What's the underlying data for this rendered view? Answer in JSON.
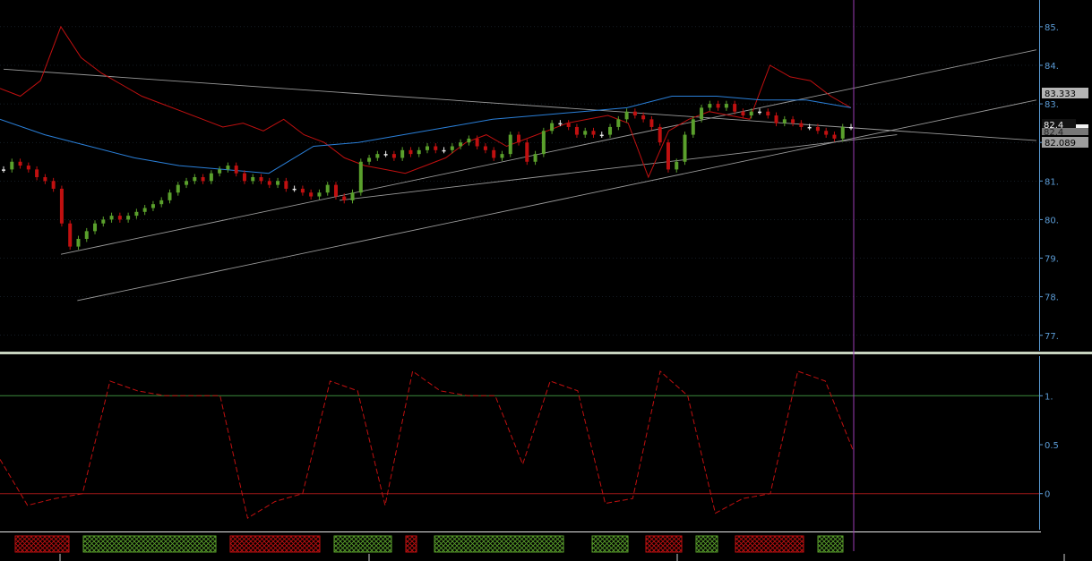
{
  "chart_data": {
    "type": "candlestick",
    "price_panel": {
      "ylim": [
        76.6,
        85.6
      ],
      "y_ticks": [
        "77.",
        "78.",
        "79.",
        "80.",
        "81.",
        "82.",
        "83.",
        "84.",
        "85."
      ],
      "tag_labels": {
        "upper": "83.333",
        "last": "82.4",
        "last_shadow": "82.4",
        "lower": "82.089"
      },
      "close_series": [
        81.3,
        81.5,
        81.4,
        81.3,
        81.1,
        81.0,
        80.8,
        79.9,
        79.3,
        79.5,
        79.7,
        79.9,
        80.0,
        80.1,
        80.0,
        80.1,
        80.2,
        80.3,
        80.4,
        80.5,
        80.7,
        80.9,
        81.0,
        81.1,
        81.0,
        81.2,
        81.3,
        81.4,
        81.2,
        81.0,
        81.1,
        81.0,
        80.9,
        81.0,
        80.8,
        80.8,
        80.7,
        80.6,
        80.7,
        80.9,
        80.6,
        80.5,
        80.7,
        81.5,
        81.6,
        81.7,
        81.7,
        81.6,
        81.8,
        81.7,
        81.8,
        81.9,
        81.8,
        81.8,
        81.9,
        82.0,
        82.1,
        81.9,
        81.8,
        81.6,
        81.7,
        82.2,
        82.0,
        81.5,
        81.7,
        82.3,
        82.5,
        82.5,
        82.4,
        82.2,
        82.3,
        82.2,
        82.2,
        82.4,
        82.6,
        82.8,
        82.7,
        82.6,
        82.4,
        82.0,
        81.3,
        81.5,
        82.2,
        82.6,
        82.9,
        83.0,
        82.9,
        83.0,
        82.8,
        82.7,
        82.8,
        82.8,
        82.7,
        82.5,
        82.6,
        82.5,
        82.4,
        82.4,
        82.3,
        82.2,
        82.1,
        82.4,
        82.4
      ],
      "red_overlay": [
        83.4,
        83.2,
        83.6,
        85.0,
        84.2,
        83.8,
        83.5,
        83.2,
        83.0,
        82.8,
        82.6,
        82.4,
        82.5,
        82.3,
        82.6,
        82.2,
        82.0,
        81.6,
        81.4,
        81.3,
        81.2,
        81.4,
        81.6,
        82.0,
        82.2,
        81.9,
        82.1,
        82.3,
        82.5,
        82.6,
        82.7,
        82.5,
        81.1,
        82.3,
        82.6,
        82.8,
        82.7,
        82.6,
        84.0,
        83.7,
        83.6,
        83.2,
        82.9
      ],
      "blue_overlay": [
        82.6,
        82.2,
        81.9,
        81.6,
        81.4,
        81.3,
        81.2,
        81.9,
        82.0,
        82.2,
        82.4,
        82.6,
        82.7,
        82.8,
        82.9,
        83.2,
        83.2,
        83.1,
        83.1,
        82.9
      ],
      "trend_lines": [
        "upper-channel",
        "mid-channel",
        "lower-channel",
        "descending-resistance"
      ]
    },
    "oscillator_panel": {
      "ylim": [
        -0.35,
        1.35
      ],
      "y_ticks": [
        "0",
        "0.5",
        "1."
      ],
      "reference_levels": [
        0,
        1
      ],
      "values": [
        0.35,
        -0.12,
        -0.05,
        0.0,
        1.15,
        1.05,
        1.0,
        1.0,
        1.0,
        -0.25,
        -0.08,
        0.0,
        1.15,
        1.05,
        -0.12,
        1.25,
        1.05,
        1.0,
        1.0,
        0.3,
        1.15,
        1.05,
        -0.1,
        -0.05,
        1.25,
        1.0,
        -0.2,
        -0.05,
        0.0,
        1.25,
        1.15,
        0.45
      ]
    },
    "signal_bar": {
      "segments": [
        {
          "state": "bear"
        },
        {
          "state": "bull"
        },
        {
          "state": "bear"
        },
        {
          "state": "bull"
        },
        {
          "state": "bear"
        },
        {
          "state": "bull"
        },
        {
          "state": "bull"
        },
        {
          "state": "bear"
        },
        {
          "state": "bull"
        },
        {
          "state": "bear"
        },
        {
          "state": "bull"
        }
      ]
    },
    "colors": {
      "background": "#000000",
      "bull_candle": "#5aa02c",
      "bear_candle": "#c01010",
      "doji_candle": "#e8e8e8",
      "red_line": "#c01010",
      "blue_line": "#2a7fd8",
      "trend_line": "#9a9a9a",
      "green_level": "#3c8a3c",
      "red_level": "#a01818",
      "cursor": "#9b3bb5",
      "axis": "#5b9bd5",
      "grid": "#2a3a4a",
      "panel_divider": "#c8d4c0"
    }
  }
}
